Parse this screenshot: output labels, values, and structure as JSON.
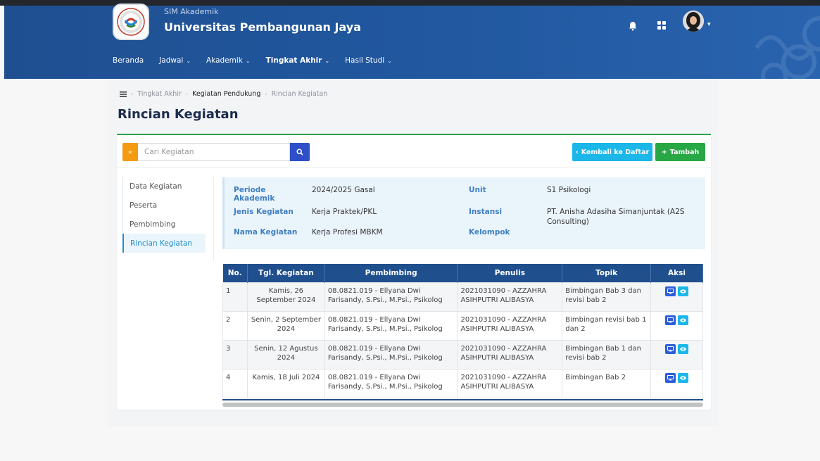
{
  "header": {
    "app_name": "SIM Akademik",
    "university": "Universitas Pembangunan Jaya"
  },
  "nav": [
    {
      "label": "Beranda",
      "has_caret": false
    },
    {
      "label": "Jadwal",
      "has_caret": true
    },
    {
      "label": "Akademik",
      "has_caret": true
    },
    {
      "label": "Tingkat Akhir",
      "has_caret": true,
      "active": true
    },
    {
      "label": "Hasil Studi",
      "has_caret": true
    }
  ],
  "breadcrumb": {
    "items": [
      "Tingkat Akhir",
      "Kegiatan Pendukung",
      "Rincian Kegiatan"
    ]
  },
  "page_title": "Rincian Kegiatan",
  "search": {
    "placeholder": "Cari Kegiatan"
  },
  "buttons": {
    "back": "Kembali ke Daftar",
    "add": "Tambah"
  },
  "sidebar": [
    "Data Kegiatan",
    "Peserta",
    "Pembimbing",
    "Rincian Kegiatan"
  ],
  "info": {
    "periode_label": "Periode Akademik",
    "periode_value": "2024/2025 Gasal",
    "jenis_label": "Jenis Kegiatan",
    "jenis_value": "Kerja Praktek/PKL",
    "nama_label": "Nama Kegiatan",
    "nama_value": "Kerja Profesi MBKM",
    "unit_label": "Unit",
    "unit_value": "S1 Psikologi",
    "instansi_label": "Instansi",
    "instansi_value": "PT. Anisha Adasiha Simanjuntak (A2S Consulting)",
    "kelompok_label": "Kelompok",
    "kelompok_value": ""
  },
  "table": {
    "headers": [
      "No.",
      "Tgl. Kegiatan",
      "Pembimbing",
      "Penulis",
      "Topik",
      "Aksi"
    ],
    "rows": [
      {
        "no": "1",
        "tgl": "Kamis, 26 September 2024",
        "pembimbing": "08.0821.019 - Ellyana Dwi Farisandy, S.Psi., M.Psi., Psikolog",
        "penulis": "2021031090 - AZZAHRA ASIHPUTRI ALIBASYA",
        "topik": "Bimbingan Bab 3 dan revisi bab 2"
      },
      {
        "no": "2",
        "tgl": "Senin, 2 September 2024",
        "pembimbing": "08.0821.019 - Ellyana Dwi Farisandy, S.Psi., M.Psi., Psikolog",
        "penulis": "2021031090 - AZZAHRA ASIHPUTRI ALIBASYA",
        "topik": "Bimbingan revisi bab 1 dan 2"
      },
      {
        "no": "3",
        "tgl": "Senin, 12 Agustus 2024",
        "pembimbing": "08.0821.019 - Ellyana Dwi Farisandy, S.Psi., M.Psi., Psikolog",
        "penulis": "2021031090 - AZZAHRA ASIHPUTRI ALIBASYA",
        "topik": "Bimbingan Bab 1 dan revisi bab 2"
      },
      {
        "no": "4",
        "tgl": "Kamis, 18 Juli 2024",
        "pembimbing": "08.0821.019 - Ellyana Dwi Farisandy, S.Psi., M.Psi., Psikolog",
        "penulis": "2021031090 - AZZAHRA ASIHPUTRI ALIBASYA",
        "topik": "Bimbingan Bab 2"
      }
    ]
  },
  "colors": {
    "primary": "#204f8e",
    "accent_cyan": "#1ab7e8",
    "success": "#28a745",
    "orange": "#f39c12"
  },
  "icons": {
    "menu": "hamburger-icon",
    "bell": "bell-icon",
    "apps": "grid-icon",
    "search": "search-icon"
  }
}
